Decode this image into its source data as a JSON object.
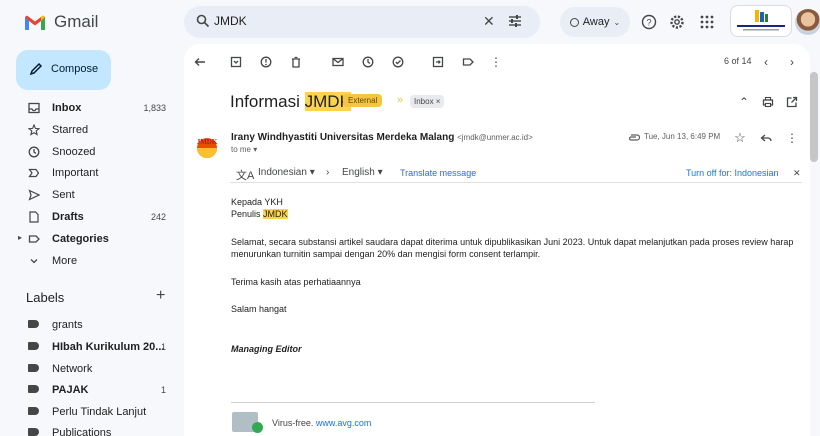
{
  "app": {
    "name": "Gmail"
  },
  "search": {
    "value": "JMDK"
  },
  "status": {
    "label": "Away"
  },
  "sidebar": {
    "compose_label": "Compose",
    "items": [
      {
        "label": "Inbox",
        "count": "1,833",
        "bold": true,
        "icon": "inbox-icon"
      },
      {
        "label": "Starred",
        "count": "",
        "bold": false,
        "icon": "star-icon"
      },
      {
        "label": "Snoozed",
        "count": "",
        "bold": false,
        "icon": "clock-icon"
      },
      {
        "label": "Important",
        "count": "",
        "bold": false,
        "icon": "important-icon"
      },
      {
        "label": "Sent",
        "count": "",
        "bold": false,
        "icon": "send-icon"
      },
      {
        "label": "Drafts",
        "count": "242",
        "bold": true,
        "icon": "draft-icon"
      },
      {
        "label": "Categories",
        "count": "",
        "bold": true,
        "icon": "label-outline-icon"
      },
      {
        "label": "More",
        "count": "",
        "bold": false,
        "icon": "chevron-down-icon"
      }
    ],
    "labels_heading": "Labels",
    "labels": [
      {
        "label": "grants",
        "count": "",
        "bold": false
      },
      {
        "label": "HIbah Kurikulum 20...",
        "count": "1",
        "bold": true
      },
      {
        "label": "Network",
        "count": "",
        "bold": false
      },
      {
        "label": "PAJAK",
        "count": "1",
        "bold": true
      },
      {
        "label": "Perlu Tindak Lanjut",
        "count": "",
        "bold": false
      },
      {
        "label": "Publications",
        "count": "",
        "bold": false
      }
    ]
  },
  "toolbar": {
    "pager": "6 of 14"
  },
  "email": {
    "subject_prefix": "Informasi ",
    "subject_highlight": "JMDK",
    "external_badge": "External",
    "inbox_badge": "Inbox ×",
    "sender_name": "Irany Windhyastiti Universitas Merdeka Malang",
    "sender_email": "<jmdk@unmer.ac.id>",
    "to": "to me ▾",
    "date": "Tue, Jun 13, 6:49 PM",
    "logo_text": "JMDK"
  },
  "translate": {
    "from": "Indonesian ▾",
    "to": "English ▾",
    "action": "Translate message",
    "turn_off": "Turn off for: Indonesian"
  },
  "body": {
    "greeting1": "Kepada YKH",
    "greeting2_prefix": "Penulis ",
    "greeting2_highlight": "JMDK",
    "para1_line1": "Selamat, secara substansi artikel saudara dapat diterima untuk dipublikasikan Juni 2023. Untuk dapat melanjutkan pada proses review harap",
    "para1_line2": "menurunkan turnitin sampai dengan 20% dan mengisi form consent terlampir.",
    "thanks": "Terima kasih atas perhatiaannya",
    "regards": "Salam hangat",
    "signature": "Managing Editor",
    "virus_prefix": "Virus-free.",
    "virus_link": "www.avg.com"
  },
  "colors": {
    "accent": "#c2e7ff",
    "highlight": "#fcd34d",
    "external": "#f4c542"
  }
}
